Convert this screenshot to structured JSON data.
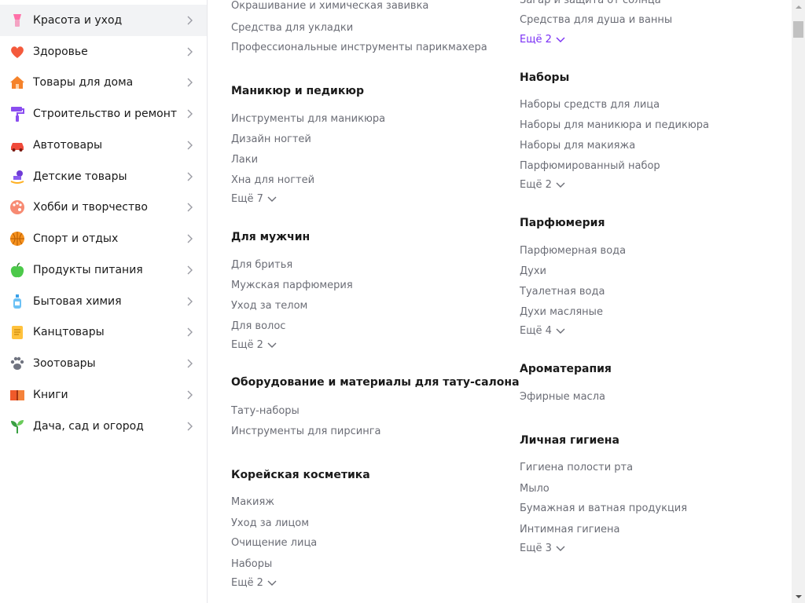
{
  "sidebar": {
    "items": [
      {
        "label": "Красота и уход",
        "icon": "lipstick-icon"
      },
      {
        "label": "Здоровье",
        "icon": "heart-icon"
      },
      {
        "label": "Товары для дома",
        "icon": "house-icon"
      },
      {
        "label": "Строительство и ремонт",
        "icon": "paint-roller-icon"
      },
      {
        "label": "Автотовары",
        "icon": "car-icon"
      },
      {
        "label": "Детские товары",
        "icon": "rocking-horse-icon"
      },
      {
        "label": "Хобби и творчество",
        "icon": "palette-icon"
      },
      {
        "label": "Спорт и отдых",
        "icon": "basketball-icon"
      },
      {
        "label": "Продукты питания",
        "icon": "apple-icon"
      },
      {
        "label": "Бытовая химия",
        "icon": "spray-bottle-icon"
      },
      {
        "label": "Канцтовары",
        "icon": "notepad-icon"
      },
      {
        "label": "Зоотовары",
        "icon": "paw-icon"
      },
      {
        "label": "Книги",
        "icon": "book-icon"
      },
      {
        "label": "Дача, сад и огород",
        "icon": "sprout-icon"
      }
    ]
  },
  "col1": {
    "top_links": [
      "Окрашивание и химическая завивка",
      "Средства для укладки",
      "Профессиональные инструменты парикмахера"
    ],
    "sections": [
      {
        "title": "Маникюр и педикюр",
        "links": [
          "Инструменты для маникюра",
          "Дизайн ногтей",
          "Лаки",
          "Хна для ногтей"
        ],
        "more": "Ещё 7"
      },
      {
        "title": "Для мужчин",
        "links": [
          "Для бритья",
          "Мужская парфюмерия",
          "Уход за телом",
          "Для волос"
        ],
        "more": "Ещё 2"
      },
      {
        "title": "Оборудование и материалы для тату-салона",
        "links": [
          "Тату-наборы",
          "Инструменты для пирсинга"
        ]
      },
      {
        "title": "Корейская косметика",
        "links": [
          "Макияж",
          "Уход за лицом",
          "Очищение лица",
          "Наборы"
        ],
        "more": "Ещё 2"
      }
    ]
  },
  "col2": {
    "top_links": [
      "Загар и защита от солнца",
      "Средства для душа и ванны"
    ],
    "top_more": "Ещё 2",
    "sections": [
      {
        "title": "Наборы",
        "links": [
          "Наборы средств для лица",
          "Наборы для маникюра и педикюра",
          "Наборы для макияжа",
          "Парфюмированный набор"
        ],
        "more": "Ещё 2"
      },
      {
        "title": "Парфюмерия",
        "links": [
          "Парфюмерная вода",
          "Духи",
          "Туалетная вода",
          "Духи масляные"
        ],
        "more": "Ещё 4"
      },
      {
        "title": "Ароматерапия",
        "links": [
          "Эфирные масла"
        ]
      },
      {
        "title": "Личная гигиена",
        "links": [
          "Гигиена полости рта",
          "Мыло",
          "Бумажная и ватная продукция",
          "Интимная гигиена"
        ],
        "more": "Ещё 3"
      }
    ]
  },
  "colors": {
    "accent": "#7a2ff5",
    "link": "#6b6d76",
    "heading": "#1a1a1a",
    "active_bg": "#f2f3f5"
  }
}
